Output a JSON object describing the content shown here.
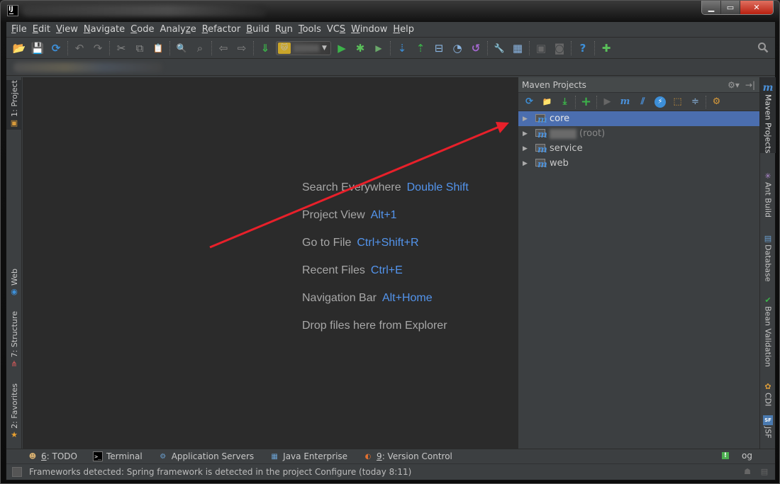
{
  "window": {
    "app_icon": "intellij-logo-icon",
    "app_icon_text": "IJ",
    "controls": {
      "minimize": "▁",
      "maximize": "▭",
      "close": "✕"
    }
  },
  "menubar": {
    "items": [
      {
        "mnemonic": "F",
        "rest": "ile"
      },
      {
        "mnemonic": "E",
        "rest": "dit"
      },
      {
        "mnemonic": "V",
        "rest": "iew"
      },
      {
        "mnemonic": "N",
        "rest": "avigate"
      },
      {
        "mnemonic": "C",
        "rest": "ode"
      },
      {
        "pre": "Analy",
        "mnemonic": "z",
        "rest": "e"
      },
      {
        "mnemonic": "R",
        "rest": "efactor"
      },
      {
        "mnemonic": "B",
        "rest": "uild"
      },
      {
        "pre": "R",
        "mnemonic": "u",
        "rest": "n"
      },
      {
        "mnemonic": "T",
        "rest": "ools"
      },
      {
        "pre": "VC",
        "mnemonic": "S",
        "rest": ""
      },
      {
        "mnemonic": "W",
        "rest": "indow"
      },
      {
        "mnemonic": "H",
        "rest": "elp"
      }
    ]
  },
  "toolbar": {
    "icons": {
      "open": "📂",
      "save": "💾",
      "sync": "⟳",
      "undo": "↶",
      "redo": "↷",
      "cut": "✂",
      "copy": "⧉",
      "paste": "📋",
      "find": "🔍",
      "replace": "⌕",
      "back": "⇦",
      "forward": "⇨",
      "make": "⇓",
      "run": "▶",
      "debug": "✱",
      "coverage": "▶",
      "vcs_update": "⇣",
      "vcs_commit": "⇡",
      "vcs_compare": "⊟",
      "vcs_history": "◔",
      "revert": "↺",
      "settings": "🔧",
      "structure": "▦",
      "avd": "▣",
      "android": "◙",
      "help": "?",
      "plugin": "✚",
      "search": "⚲"
    },
    "run_config": {
      "icon": "tomcat-icon",
      "caret": "▼"
    }
  },
  "left_stripe": [
    {
      "label": "1: Project",
      "icon": "▣"
    },
    {
      "label": "Web",
      "icon": "◉"
    },
    {
      "label": "7: Structure",
      "icon": "⋔"
    },
    {
      "label": "2: Favorites",
      "icon": "★"
    }
  ],
  "right_stripe": [
    {
      "label": "Maven Projects",
      "icon": "m"
    },
    {
      "label": "Ant Build",
      "icon": "✳"
    },
    {
      "label": "Database",
      "icon": "▤"
    },
    {
      "label": "Bean Validation",
      "icon": "✔"
    },
    {
      "label": "CDI",
      "icon": "✿"
    },
    {
      "label": "JSF",
      "icon": "SF"
    }
  ],
  "editor": {
    "hints": [
      {
        "text": "Search Everywhere",
        "key": "Double Shift"
      },
      {
        "text": "Project View",
        "key": "Alt+1"
      },
      {
        "text": "Go to File",
        "key": "Ctrl+Shift+R"
      },
      {
        "text": "Recent Files",
        "key": "Ctrl+E"
      },
      {
        "text": "Navigation Bar",
        "key": "Alt+Home"
      },
      {
        "text": "Drop files here from Explorer",
        "key": ""
      }
    ]
  },
  "maven": {
    "title": "Maven Projects",
    "header_actions": {
      "settings": "⚙▾",
      "hide": "→|"
    },
    "toolbar_icons": {
      "reimport": "⟳",
      "generate_sources": "📁",
      "download": "⤓",
      "add": "+",
      "run": "▶",
      "execute_goal": "m",
      "toggle_offline": "⫽",
      "skip_tests": "⚡",
      "show_dependencies": "⬚",
      "collapse_all": "≑",
      "settings": "⚙"
    },
    "tree": [
      {
        "name": "core",
        "suffix": "",
        "selected": true,
        "blurred": false
      },
      {
        "name": "",
        "suffix": "(root)",
        "selected": false,
        "blurred": true
      },
      {
        "name": "service",
        "suffix": "",
        "selected": false,
        "blurred": false
      },
      {
        "name": "web",
        "suffix": "",
        "selected": false,
        "blurred": false
      }
    ],
    "expand_glyph": "▶",
    "module_glyph": "m"
  },
  "bottom_tools": [
    {
      "mnemonic": "6",
      "label": ": TODO",
      "icon": "☻"
    },
    {
      "mnemonic": "",
      "label": "Terminal",
      "icon": ">_"
    },
    {
      "mnemonic": "",
      "label": "Application Servers",
      "icon": "⚙"
    },
    {
      "mnemonic": "",
      "label": "Java Enterprise",
      "icon": "▦"
    },
    {
      "mnemonic": "9",
      "label": ": Version Control",
      "icon": "◐"
    }
  ],
  "event_log": {
    "label": "Event Log",
    "visible_fragment": "og",
    "badge": "!"
  },
  "status": {
    "message": "Frameworks detected: Spring framework is detected in the project Configure (today 8:11)"
  },
  "annotation": {
    "arrow_color": "#e8202a"
  },
  "colors": {
    "accent": "#4b6eaf",
    "hint_key": "#5394ec",
    "editor_bg": "#2b2b2b",
    "panel_bg": "#3c3f41"
  }
}
